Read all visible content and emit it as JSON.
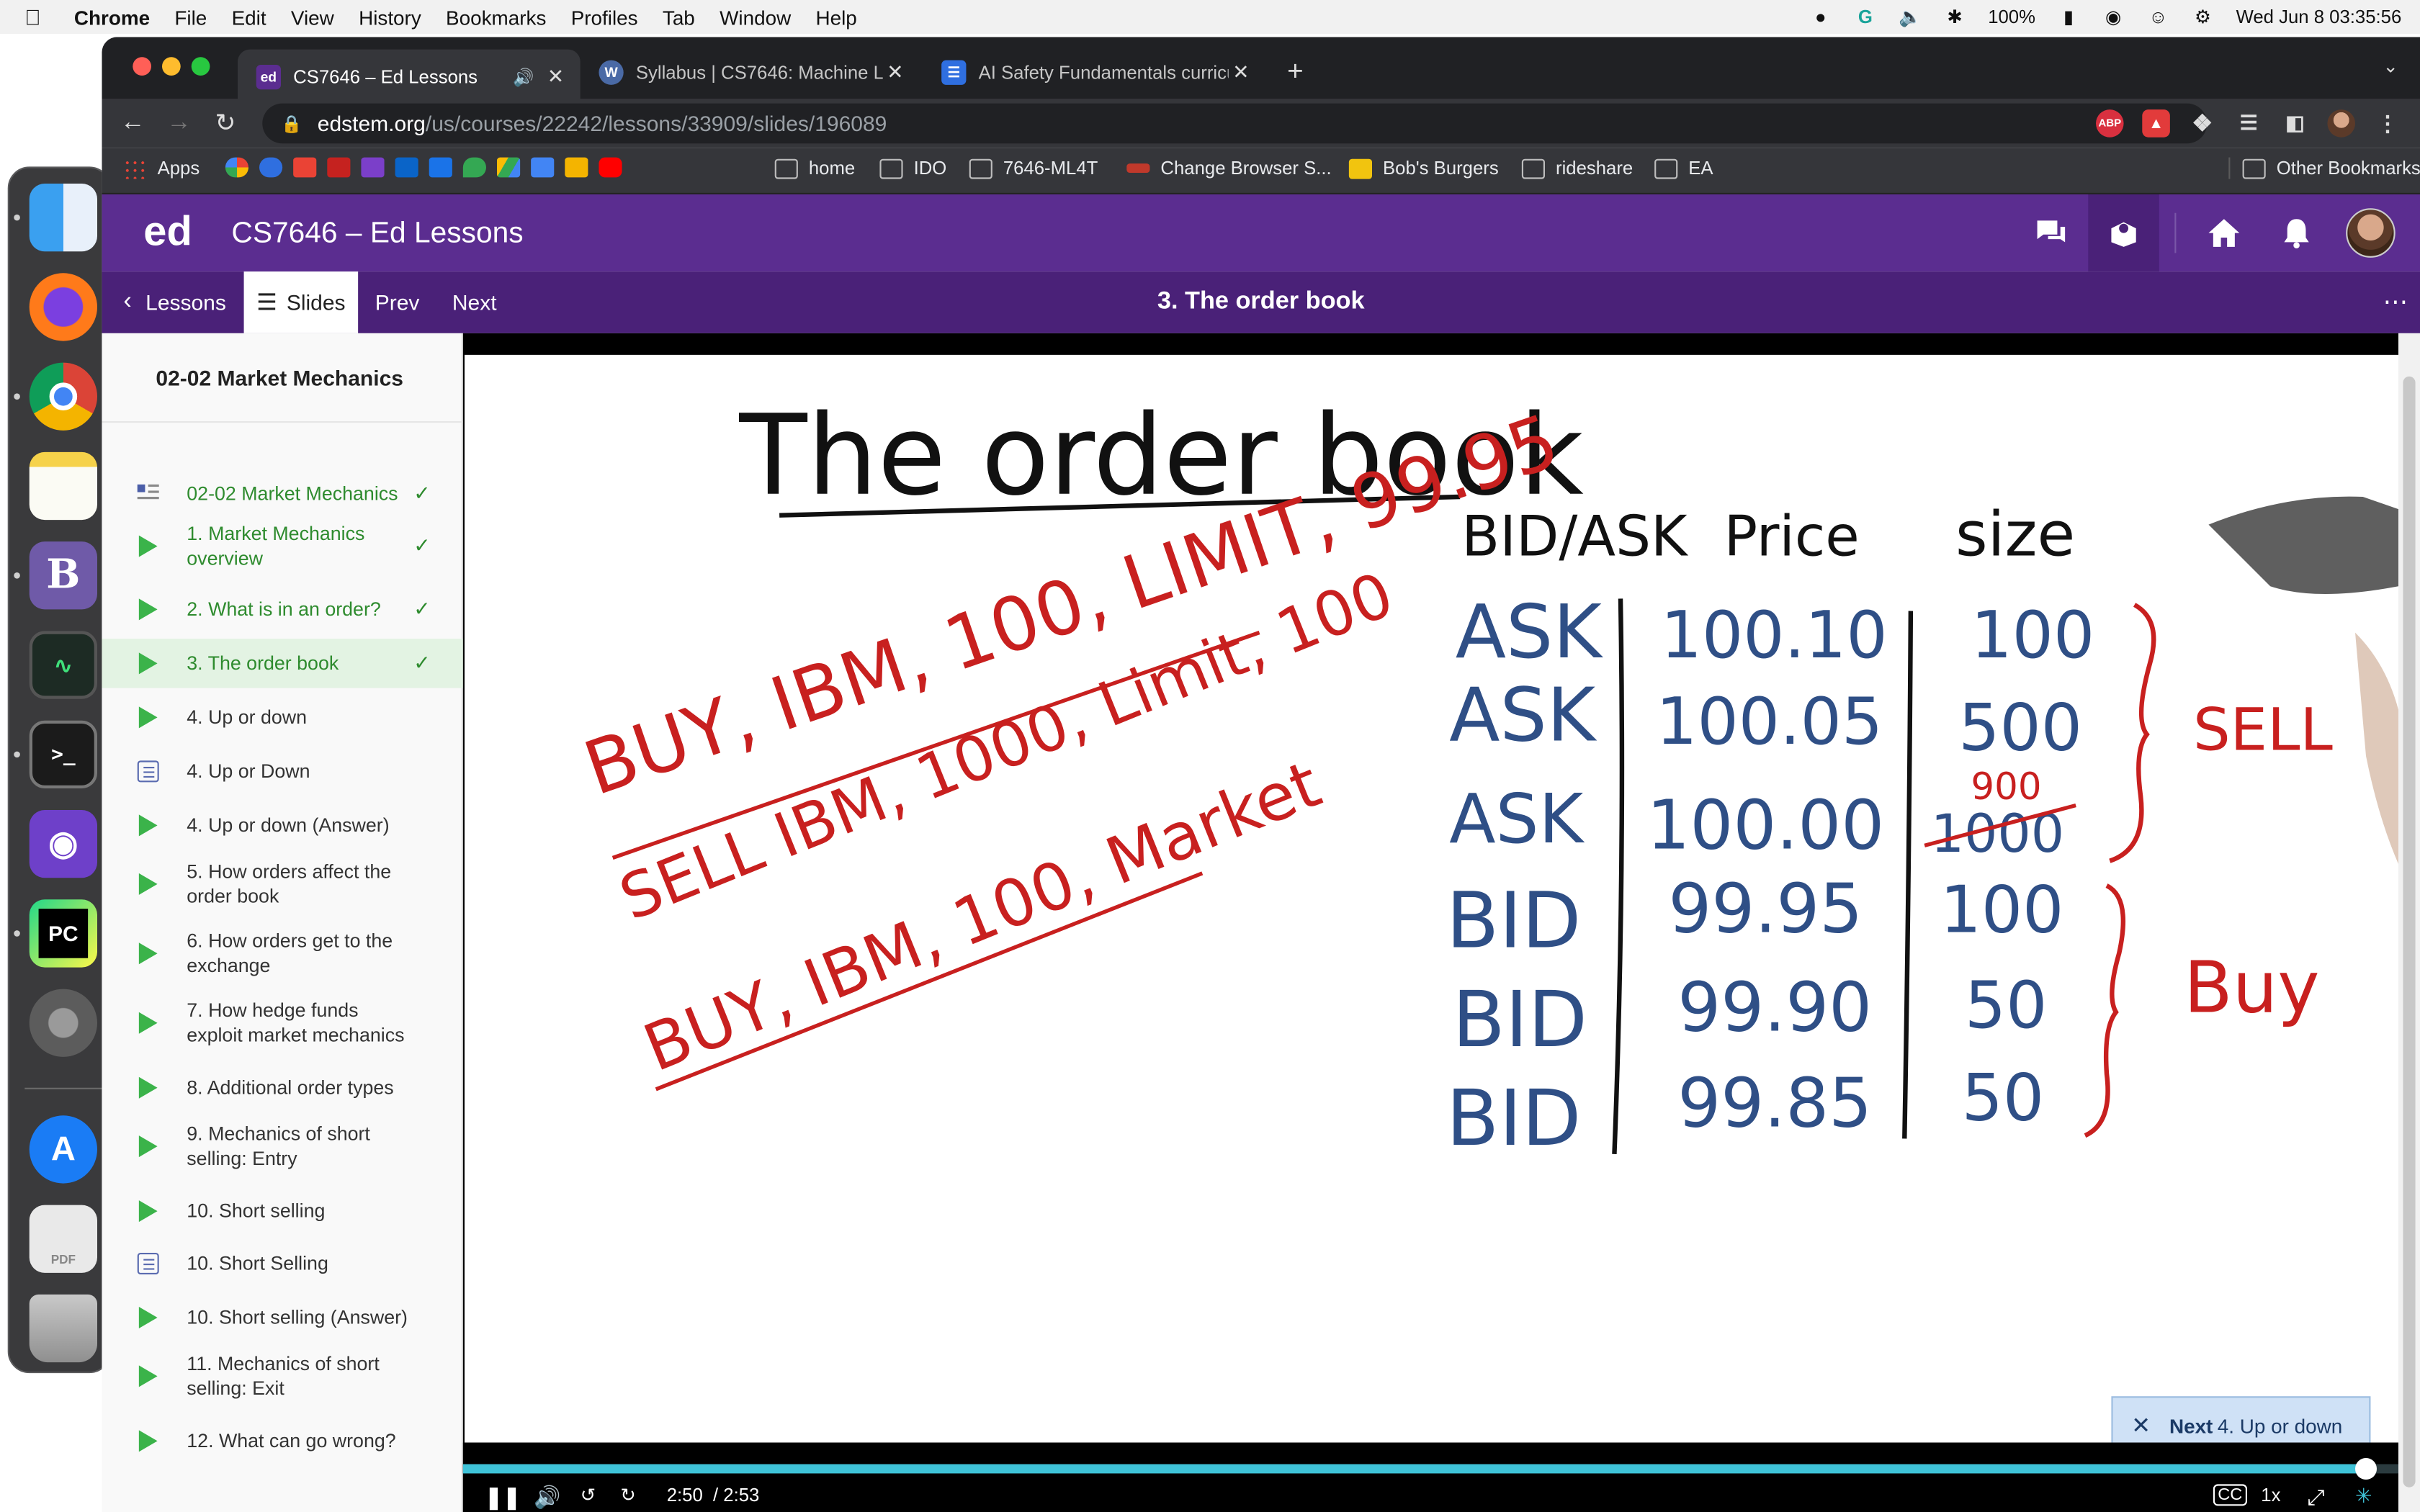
{
  "menubar": {
    "app": "Chrome",
    "items": [
      "File",
      "Edit",
      "View",
      "History",
      "Bookmarks",
      "Profiles",
      "Tab",
      "Window",
      "Help"
    ],
    "battery": "100%",
    "clock": "Wed Jun 8  03:35:56"
  },
  "tabs": [
    {
      "title": "CS7646 – Ed Lessons",
      "favicon": "ed",
      "active": true
    },
    {
      "title": "Syllabus | CS7646: Machine Le",
      "favicon": "W"
    },
    {
      "title": "AI Safety Fundamentals curricu",
      "favicon": "doc"
    }
  ],
  "address": {
    "host": "edstem.org",
    "path": "/us/courses/22242/lessons/33909/slides/196089"
  },
  "bookmarks": {
    "items": [
      "Apps",
      "home",
      "IDO",
      "7646-ML4T",
      "Change Browser S...",
      "Bob's Burgers",
      "rideshare",
      "EA"
    ],
    "other": "Other Bookmarks"
  },
  "ed": {
    "logo": "ed",
    "course": "CS7646 – Ed Lessons"
  },
  "lesson_nav": {
    "lessons": "Lessons",
    "slides": "Slides",
    "prev": "Prev",
    "next": "Next",
    "title": "3. The order book"
  },
  "sidebar": {
    "title": "02-02 Market Mechanics",
    "items": [
      {
        "label": "02-02 Market Mechanics",
        "icon": "text-doc-icon",
        "done": true
      },
      {
        "label": "1. Market Mechanics overview",
        "icon": "play-icon",
        "done": true
      },
      {
        "label": "2. What is in an order?",
        "icon": "play-icon",
        "done": true
      },
      {
        "label": "3. The order book",
        "icon": "play-icon",
        "done": true,
        "current": true
      },
      {
        "label": "4. Up or down",
        "icon": "play-icon"
      },
      {
        "label": "4. Up or Down",
        "icon": "quiz-icon"
      },
      {
        "label": "4. Up or down (Answer)",
        "icon": "play-icon"
      },
      {
        "label": "5. How orders affect the order book",
        "icon": "play-icon"
      },
      {
        "label": "6. How orders get to the exchange",
        "icon": "play-icon"
      },
      {
        "label": "7. How hedge funds exploit market mechanics",
        "icon": "play-icon"
      },
      {
        "label": "8. Additional order types",
        "icon": "play-icon"
      },
      {
        "label": "9. Mechanics of short selling: Entry",
        "icon": "play-icon"
      },
      {
        "label": "10. Short selling",
        "icon": "play-icon"
      },
      {
        "label": "10. Short Selling",
        "icon": "quiz-icon"
      },
      {
        "label": "10. Short selling (Answer)",
        "icon": "play-icon"
      },
      {
        "label": "11. Mechanics of short selling: Exit",
        "icon": "play-icon"
      },
      {
        "label": "12. What can go wrong?",
        "icon": "play-icon"
      }
    ]
  },
  "slide": {
    "heading": "The order book",
    "orders": [
      "BUY, IBM, 100, LIMIT, 99.95",
      "SELL IBM, 1000, Limit, 100",
      "BUY, IBM, 100, Market"
    ],
    "columns": [
      "BID/ASK",
      "Price",
      "size"
    ],
    "rows": [
      {
        "side": "ASK",
        "price": "100.10",
        "size": "100"
      },
      {
        "side": "ASK",
        "price": "100.05",
        "size": "500"
      },
      {
        "side": "ASK",
        "price": "100.00",
        "size": "1000",
        "size_corrected": "900"
      },
      {
        "side": "BID",
        "price": "99.95",
        "size": "100"
      },
      {
        "side": "BID",
        "price": "99.90",
        "size": "50"
      },
      {
        "side": "BID",
        "price": "99.85",
        "size": "50"
      }
    ],
    "sell_label": "SELL",
    "buy_label": "Buy"
  },
  "player": {
    "current_time": "2:50",
    "duration": "/ 2:53",
    "progress": 0.983,
    "speed": "1x",
    "next_prefix": "Next",
    "next_title": "4. Up or down"
  },
  "colors": {
    "ed_purple": "#5b2d90",
    "ed_purple_dark": "#4a2178",
    "ink_red": "#c8201f",
    "ink_blue": "#2f4f86",
    "ink_black": "#111111",
    "done_green": "#2e8b2e"
  }
}
